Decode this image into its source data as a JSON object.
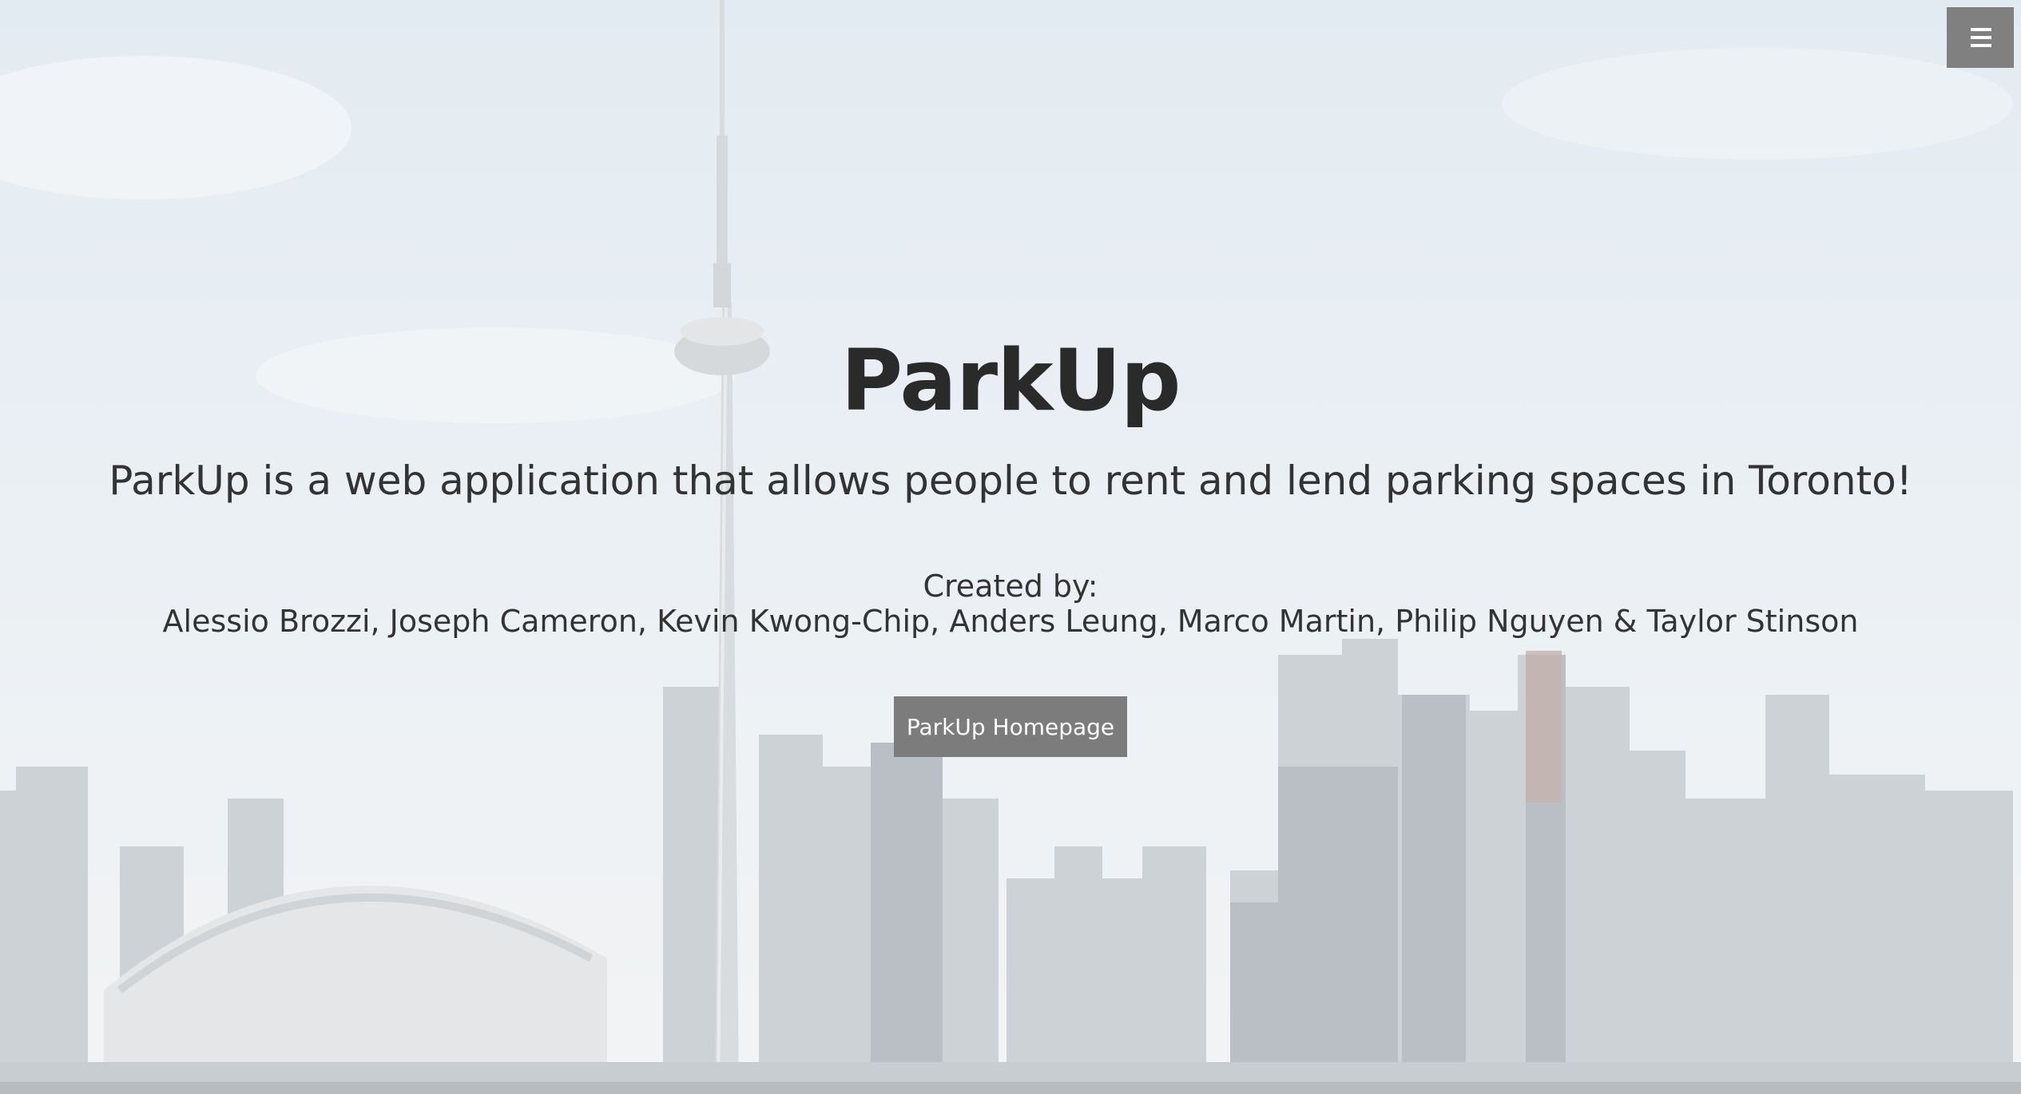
{
  "hero": {
    "title": "ParkUp",
    "tagline": "ParkUp is a web application that allows people to rent and lend parking spaces in Toronto!",
    "credits_label": "Created by:",
    "credits_names": "Alessio Brozzi, Joseph Cameron, Kevin Kwong-Chip, Anders Leung, Marco Martin, Philip Nguyen & Taylor Stinson",
    "button_label": "ParkUp Homepage"
  },
  "menu": {
    "icon": "hamburger-menu-icon"
  },
  "background": {
    "scene": "toronto-skyline-image",
    "sky_color": "#dbe6ef",
    "building_color": "#c9ced3",
    "button_color": "#7c7c7c",
    "text_color": "#2b2b2b"
  }
}
